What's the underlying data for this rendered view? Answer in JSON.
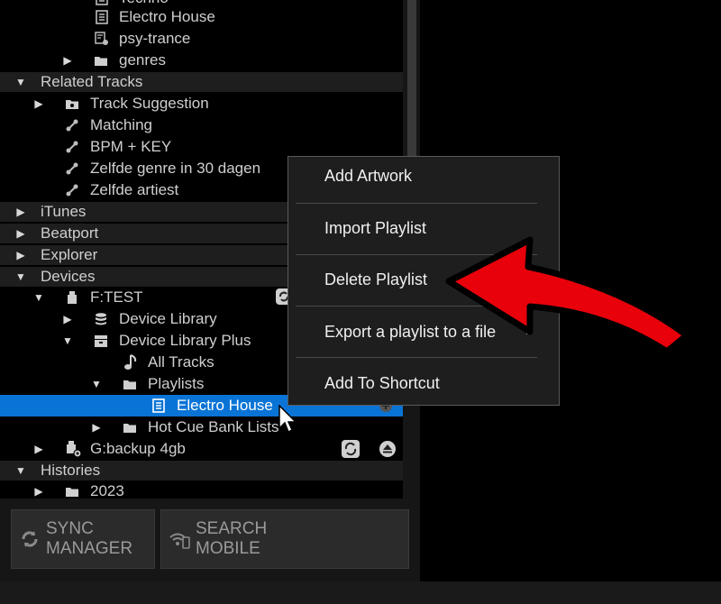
{
  "tree": {
    "partial_top": "Techno",
    "electro_house": "Electro House",
    "psy_trance": "psy-trance",
    "genres": "genres",
    "related_tracks": "Related Tracks",
    "track_suggestion": "Track Suggestion",
    "matching": "Matching",
    "bpm_key": "BPM + KEY",
    "zelfde_genre": "Zelfde genre in 30 dagen",
    "zelfde_artiest": "Zelfde artiest",
    "itunes": "iTunes",
    "beatport": "Beatport",
    "explorer": "Explorer",
    "devices": "Devices",
    "f_test": "F:TEST",
    "device_library": "Device Library",
    "device_library_plus": "Device Library Plus",
    "all_tracks": "All Tracks",
    "playlists": "Playlists",
    "selected_playlist": "Electro House",
    "hot_cue": "Hot Cue Bank Lists",
    "g_backup": "G:backup 4gb",
    "histories": "Histories",
    "year_2023": "2023"
  },
  "context_menu": {
    "items": [
      "Add Artwork",
      "Import Playlist",
      "Delete Playlist",
      "Export a playlist to a file",
      "Add To Shortcut"
    ]
  },
  "buttons": {
    "sync_line1": "SYNC",
    "sync_line2": "MANAGER",
    "search_line1": "SEARCH",
    "search_line2": "MOBILE"
  },
  "colors": {
    "selection": "#0a74d6",
    "annotation_arrow": "#e8000b"
  }
}
